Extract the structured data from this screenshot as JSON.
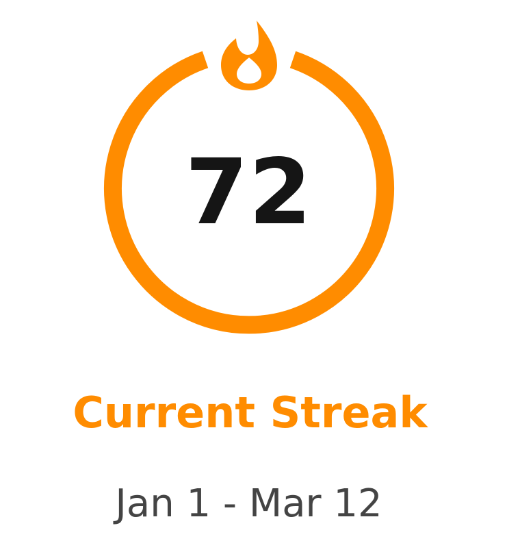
{
  "streak": {
    "count": "72",
    "title": "Current Streak",
    "date_range": "Jan 1 - Mar 12",
    "icon": "flame-icon"
  },
  "colors": {
    "accent": "#FF8C00",
    "count_text": "#151515",
    "range_text": "#444444",
    "background": "#FFFFFF"
  }
}
